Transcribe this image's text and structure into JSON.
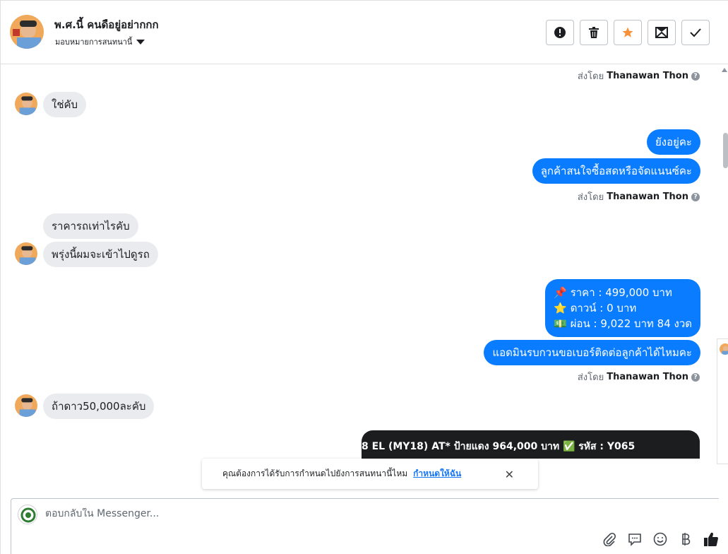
{
  "header": {
    "contact_name": "พ.ศ.นี้ คนดือยู่อย่ากกก",
    "assign_label": "มอบหมายการสนทนานี้"
  },
  "thread": {
    "sender_label": "ส่งโดย",
    "sender_name": "Thanawan Thon",
    "messages": {
      "in1": "ใช่คับ",
      "out1": "ยังอยู่คะ",
      "out2": "ลูกค้าสนใจซื้อสดหรือจัดแนนซ์คะ",
      "in2": "ราคารถเท่าไรคับ",
      "in3": "พรุ่งนี้ผมจะเข้าไปดูรถ",
      "price_line1": "📌 ราคา : 499,000 บาท",
      "price_line2": "⭐ ดาวน์ : 0 บาท",
      "price_line3": "💵 ผ่อน : 9,022 บาท 84 งวด",
      "out3": "แอดมินรบกวนขอเบอร์ติดต่อลูกค้าได้ไหมคะ",
      "in4": "ถ้าดาว50,000ละคับ",
      "image_caption": "8 EL (MY18) AT* ป้ายแดง 964,000 บาท ✅ รหัส : Y065"
    }
  },
  "toast": {
    "text": "คุณต้องการได้รับการกำหนดไปยังการสนทนานี้ไหม",
    "link": "กำหนดให้ฉัน",
    "close": "✕"
  },
  "composer": {
    "placeholder": "ตอบกลับใน Messenger..."
  },
  "icons": {
    "report": "exclamation-circle-icon",
    "delete": "trash-icon",
    "star": "star-icon",
    "unread": "envelope-icon",
    "done": "check-icon",
    "attach": "paperclip-icon",
    "saved_replies": "chat-bubble-icon",
    "emoji": "smiley-icon",
    "payment": "baht-icon",
    "like": "thumbs-up-icon"
  },
  "colors": {
    "accent": "#0a7cff",
    "star": "#f7923b",
    "incoming_bubble": "#e9ebee"
  }
}
